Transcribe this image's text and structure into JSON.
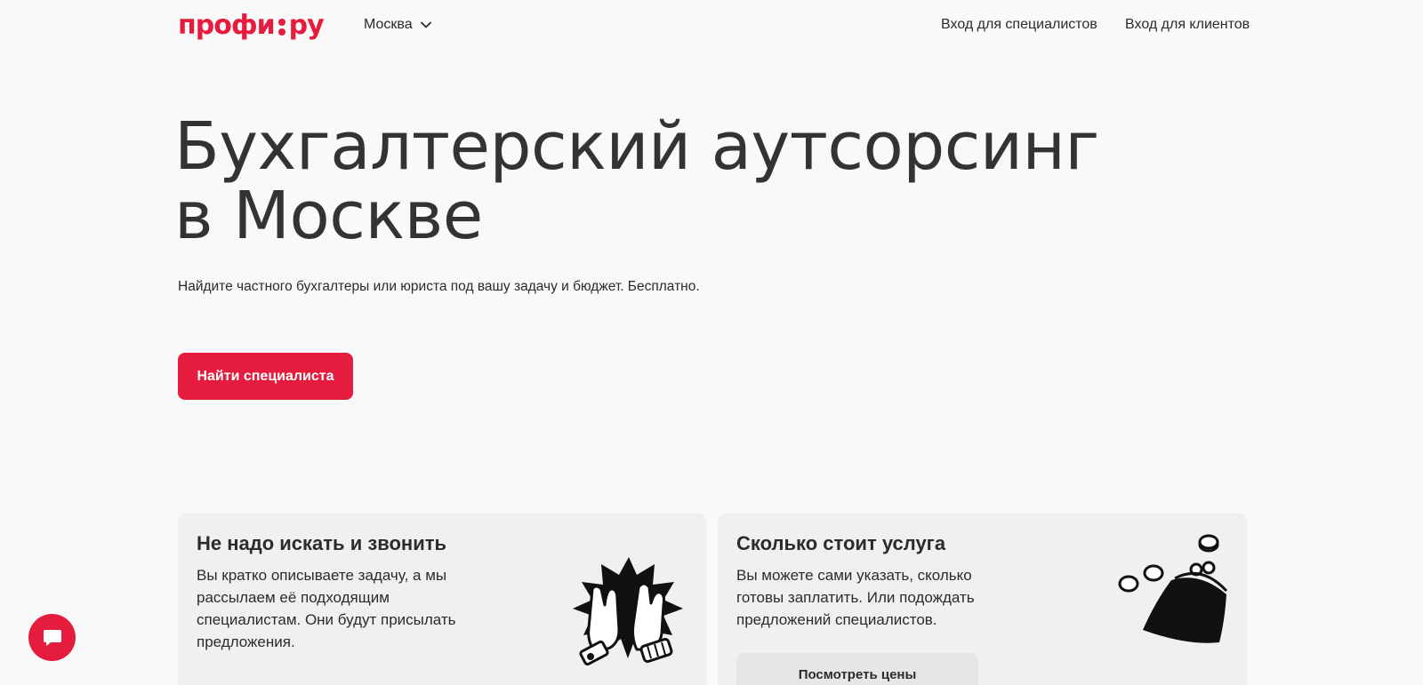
{
  "header": {
    "logo_left": "профи",
    "logo_right": "ру",
    "city": "Москва",
    "nav_specialists": "Вход для специалистов",
    "nav_clients": "Вход для клиентов"
  },
  "hero": {
    "title_line1": "Бухгалтерский аутсорсинг",
    "title_line2": "в Москве",
    "subtitle": "Найдите частного бухгалтеры или юриста под вашу задачу и бюджет. Бесплатно.",
    "cta_label": "Найти специалиста"
  },
  "cards": [
    {
      "title": "Не надо искать и звонить",
      "text": "Вы кратко описываете задачу, а мы рассылаем её подходящим специалистам. Они будут присылать предложения.",
      "illustration": "high-five-gloves-icon"
    },
    {
      "title": "Сколько стоит услуга",
      "text": "Вы можете сами указать, сколько готовы заплатить. Или подождать предложений специалистов.",
      "illustration": "coin-purse-icon",
      "button_label": "Посмотреть цены"
    }
  ],
  "chat": {
    "icon": "chat-bubble-icon"
  },
  "colors": {
    "brand": "#e51c3d",
    "background": "#f9f9f9",
    "card": "#f0f0f0",
    "text": "#2b2b2b"
  }
}
